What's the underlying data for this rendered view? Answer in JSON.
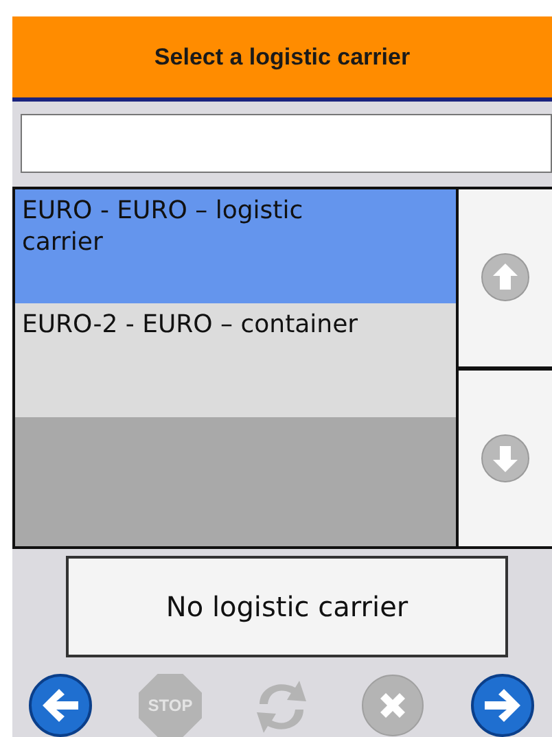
{
  "header": {
    "title": "Select a logistic carrier"
  },
  "list": {
    "items": [
      {
        "label": "EURO - EURO – logistic carrier",
        "selected": true
      },
      {
        "label": "EURO-2 - EURO – container",
        "selected": false
      }
    ]
  },
  "scroll_buttons": [
    {
      "kind": "up",
      "disabled": true
    },
    {
      "kind": "down",
      "disabled": true
    }
  ],
  "no_carrier_button": {
    "label": "No logistic carrier"
  },
  "toolbar": [
    {
      "kind": "back",
      "disabled": false
    },
    {
      "kind": "stop",
      "label": "STOP",
      "disabled": true
    },
    {
      "kind": "refresh",
      "disabled": true
    },
    {
      "kind": "cancel",
      "disabled": true
    },
    {
      "kind": "next",
      "disabled": false
    }
  ]
}
